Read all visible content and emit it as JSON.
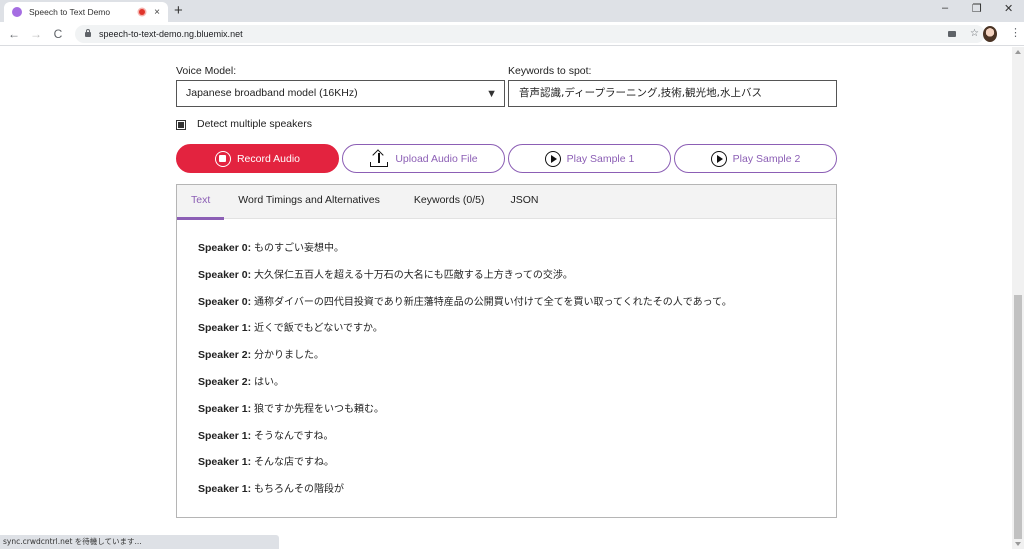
{
  "browser": {
    "tab_title": "Speech to Text Demo",
    "new_tab": "+",
    "close_tab": "×",
    "minimize": "–",
    "maximize": "❐",
    "close_window": "✕",
    "back": "←",
    "forward": "→",
    "reload": "C",
    "url": "speech-to-text-demo.ng.bluemix.net",
    "star": "☆",
    "menu": "⋮",
    "status": "sync.crwdcntrl.net を待機しています..."
  },
  "form": {
    "voice_model_label": "Voice Model:",
    "voice_model_value": "Japanese broadband model (16KHz)",
    "voice_model_arrow": "▼",
    "keywords_label": "Keywords to spot:",
    "keywords_value": "音声認識,ディープラーニング,技術,観光地,水上バス",
    "detect_speakers_label": "Detect multiple speakers",
    "detect_speakers_checked": true
  },
  "buttons": {
    "record": "Record Audio",
    "upload": "Upload Audio File",
    "sample1": "Play Sample 1",
    "sample2": "Play Sample 2"
  },
  "colors": {
    "accent": "#8c5fb5",
    "record": "#e3233f"
  },
  "tabs": [
    {
      "label": "Text",
      "active": true
    },
    {
      "label": "Word Timings and Alternatives",
      "active": false
    },
    {
      "label": "Keywords (0/5)",
      "active": false
    },
    {
      "label": "JSON",
      "active": false
    }
  ],
  "transcript": [
    {
      "speaker": "Speaker 0:",
      "text": "ものすごい妄想中。"
    },
    {
      "speaker": "Speaker 0:",
      "text": "大久保仁五百人を超える十万石の大名にも匹敵する上方きっての交渉。"
    },
    {
      "speaker": "Speaker 0:",
      "text": "通称ダイバーの四代目投資であり新庄藩特産品の公開買い付けて全てを買い取ってくれたその人であって。"
    },
    {
      "speaker": "Speaker 1:",
      "text": "近くで飯でもどないですか。"
    },
    {
      "speaker": "Speaker 2:",
      "text": "分かりました。"
    },
    {
      "speaker": "Speaker 2:",
      "text": "はい。"
    },
    {
      "speaker": "Speaker 1:",
      "text": "狼ですか先程をいつも頼む。"
    },
    {
      "speaker": "Speaker 1:",
      "text": "そうなんですね。"
    },
    {
      "speaker": "Speaker 1:",
      "text": "そんな店ですね。"
    },
    {
      "speaker": "Speaker 1:",
      "text": "もちろんその階段が"
    }
  ]
}
